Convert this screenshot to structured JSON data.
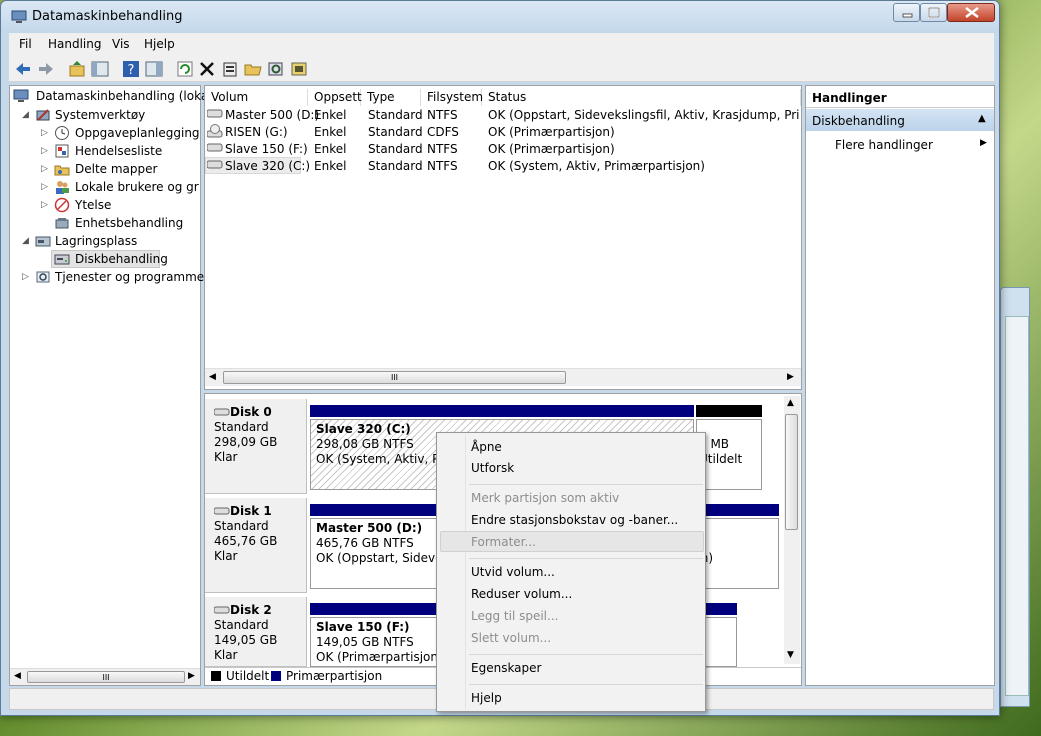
{
  "window": {
    "title": "Datamaskinbehandling"
  },
  "menu": [
    "Fil",
    "Handling",
    "Vis",
    "Hjelp"
  ],
  "toolbar_icons": [
    "back-arrow-icon",
    "forward-arrow-icon",
    "up-folder-icon",
    "show-hide-tree-icon",
    "help-icon",
    "show-hide-action-pane-icon",
    "refresh-icon",
    "delete-icon",
    "properties-icon",
    "open-icon",
    "search-disk-icon",
    "rescan-disks-icon"
  ],
  "tree": {
    "root": "Datamaskinbehandling (lokal)",
    "systemverktoy": "Systemverktøy",
    "oppgave": "Oppgaveplanlegging",
    "hendelse": "Hendelsesliste",
    "delte": "Delte mapper",
    "lokale": "Lokale brukere og grupper",
    "ytelse": "Ytelse",
    "enhet": "Enhetsbehandling",
    "lagring": "Lagringsplass",
    "disk": "Diskbehandling",
    "tjenester": "Tjenester og programmer"
  },
  "volumes": {
    "columns": [
      "Volum",
      "Oppsett",
      "Type",
      "Filsystem",
      "Status"
    ],
    "rows": [
      {
        "name": "Master 500 (D:)",
        "layout": "Enkel",
        "type": "Standard",
        "fs": "NTFS",
        "status": "OK (Oppstart, Sidevekslingsfil, Aktiv, Krasjdump, Primærpartisjon)"
      },
      {
        "name": "RISEN (G:)",
        "layout": "Enkel",
        "type": "Standard",
        "fs": "CDFS",
        "status": "OK (Primærpartisjon)"
      },
      {
        "name": "Slave 150 (F:)",
        "layout": "Enkel",
        "type": "Standard",
        "fs": "NTFS",
        "status": "OK (Primærpartisjon)"
      },
      {
        "name": "Slave 320 (C:)",
        "layout": "Enkel",
        "type": "Standard",
        "fs": "NTFS",
        "status": "OK (System, Aktiv, Primærpartisjon)"
      }
    ]
  },
  "disks": [
    {
      "name": "Disk 0",
      "type": "Standard",
      "size": "298,09 GB",
      "state": "Klar",
      "part_name": "Slave 320  (C:)",
      "part_size": "298,08 GB NTFS",
      "part_status": "OK (System, Aktiv, Primærpartisjon)",
      "unalloc_size": "8 MB",
      "unalloc_label": "Utildelt"
    },
    {
      "name": "Disk 1",
      "type": "Standard",
      "size": "465,76 GB",
      "state": "Klar",
      "part_name": "Master 500  (D:)",
      "part_size": "465,76 GB NTFS",
      "part_status": "OK (Oppstart, Sidevekslingsfil, Aktiv, Krasjdump, Primærpartisjon)"
    },
    {
      "name": "Disk 2",
      "type": "Standard",
      "size": "149,05 GB",
      "state": "Klar",
      "part_name": "Slave 150  (F:)",
      "part_size": "149,05 GB NTFS",
      "part_status": "OK (Primærpartisjon)"
    }
  ],
  "legend": {
    "unalloc": "Utildelt",
    "primary": "Primærpartisjon",
    "unalloc_color": "#000000",
    "primary_color": "#00007e"
  },
  "actions": {
    "header": "Handlinger",
    "section": "Diskbehandling",
    "more": "Flere handlinger"
  },
  "context_menu": {
    "open": "Åpne",
    "explore": "Utforsk",
    "mark_active": "Merk partisjon som aktiv",
    "change_letter": "Endre stasjonsbokstav og -baner...",
    "format": "Formater...",
    "extend": "Utvid volum...",
    "shrink": "Reduser volum...",
    "mirror": "Legg til speil...",
    "delete": "Slett volum...",
    "properties": "Egenskaper",
    "help": "Hjelp"
  },
  "scroll_glyph": "III"
}
